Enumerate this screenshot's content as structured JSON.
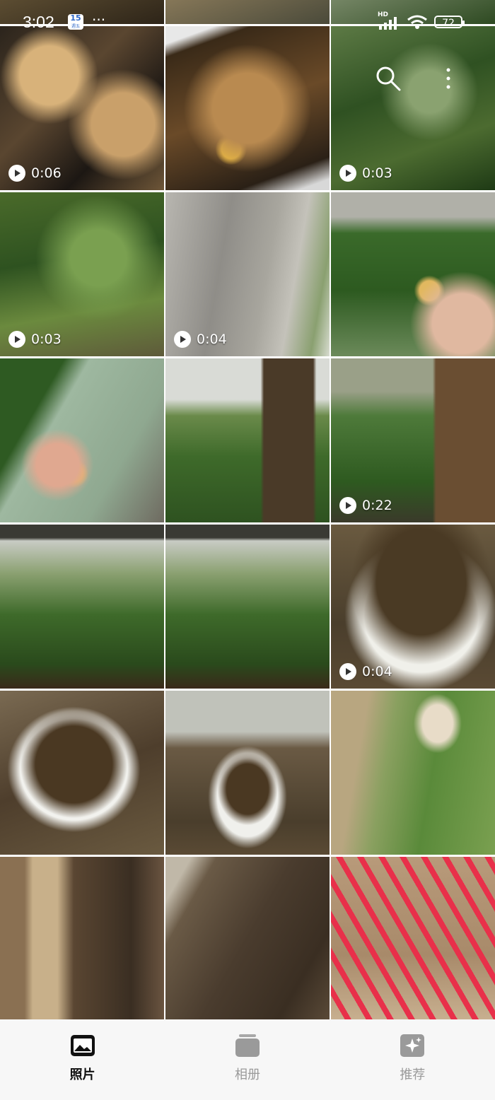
{
  "status_bar": {
    "time": "3:02",
    "date_badge_day": "15",
    "date_badge_sub": "週五",
    "network": "HD",
    "battery": "72"
  },
  "thumbnails": [
    {
      "kind": "video",
      "duration": "",
      "desc": "cropped-top"
    },
    {
      "kind": "photo",
      "duration": "",
      "desc": "cropped-top"
    },
    {
      "kind": "photo",
      "duration": "",
      "desc": "cropped-top"
    },
    {
      "kind": "video",
      "duration": "0:06"
    },
    {
      "kind": "photo",
      "duration": ""
    },
    {
      "kind": "video",
      "duration": "0:03"
    },
    {
      "kind": "video",
      "duration": "0:03"
    },
    {
      "kind": "video",
      "duration": "0:04"
    },
    {
      "kind": "photo",
      "duration": ""
    },
    {
      "kind": "photo",
      "duration": ""
    },
    {
      "kind": "photo",
      "duration": ""
    },
    {
      "kind": "video",
      "duration": "0:22"
    },
    {
      "kind": "photo",
      "duration": ""
    },
    {
      "kind": "photo",
      "duration": ""
    },
    {
      "kind": "video",
      "duration": "0:04"
    },
    {
      "kind": "photo",
      "duration": ""
    },
    {
      "kind": "photo",
      "duration": ""
    },
    {
      "kind": "photo",
      "duration": ""
    },
    {
      "kind": "photo",
      "duration": ""
    },
    {
      "kind": "photo",
      "duration": ""
    },
    {
      "kind": "photo",
      "duration": ""
    }
  ],
  "nav": {
    "photos": "照片",
    "albums": "相册",
    "recommend": "推荐"
  },
  "colors": {
    "nav_active": "#111111",
    "nav_inactive": "#9a9a9a",
    "nav_bg": "#f7f7f7"
  }
}
